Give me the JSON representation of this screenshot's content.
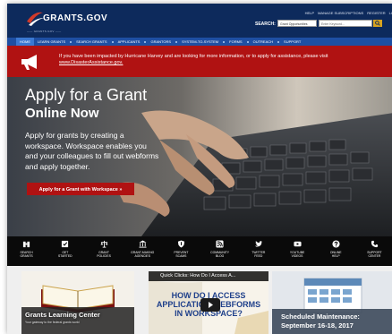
{
  "header": {
    "logo_text": "GRANTS.GOV",
    "tagline": "—— GRANTS.GOV ——",
    "util_links": [
      "HELP",
      "MANAGE SUBSCRIPTIONS",
      "REGISTER",
      "LO"
    ],
    "search_label": "SEARCH:",
    "search_select": "Grant Opportunities",
    "search_placeholder": "Enter Keyword..."
  },
  "nav": {
    "items": [
      "HOME",
      "LEARN GRANTS",
      "SEARCH GRANTS",
      "APPLICANTS",
      "GRANTORS",
      "SYSTEM-TO-SYSTEM",
      "FORMS",
      "OUTREACH",
      "SUPPORT"
    ]
  },
  "alert": {
    "text": "If you have been impacted by Hurricane Harvey and are looking for more information, or to apply for assistance, please visit",
    "link": "www.DisasterAssistance.gov."
  },
  "hero": {
    "title_line1": "Apply for a Grant",
    "title_line2": "Online Now",
    "body": "Apply for grants by creating a workspace. Workspace enables you and your colleagues to fill out webforms and apply together.",
    "cta": "Apply for a Grant with Workspace »"
  },
  "iconbar": {
    "items": [
      {
        "label1": "SEARCH",
        "label2": "GRANTS",
        "icon": "binoculars-icon"
      },
      {
        "label1": "GET",
        "label2": "STARTED",
        "icon": "checkbox-icon"
      },
      {
        "label1": "GRANT",
        "label2": "POLICIES",
        "icon": "scales-icon"
      },
      {
        "label1": "GRANT-MAKING",
        "label2": "AGENCIES",
        "icon": "building-icon"
      },
      {
        "label1": "PREVENT",
        "label2": "SCAMS",
        "icon": "shield-icon"
      },
      {
        "label1": "COMMUNITY",
        "label2": "BLOG",
        "icon": "rss-icon"
      },
      {
        "label1": "TWITTER",
        "label2": "FEED",
        "icon": "twitter-icon"
      },
      {
        "label1": "YOUTUBE",
        "label2": "VIDEOS",
        "icon": "youtube-icon"
      },
      {
        "label1": "ONLINE",
        "label2": "HELP",
        "icon": "help-icon"
      },
      {
        "label1": "SUPPORT",
        "label2": "CENTER",
        "icon": "phone-icon"
      }
    ]
  },
  "cards": {
    "learning": {
      "title": "Grants Learning Center",
      "subtitle": "Your gateway to the federal grants world"
    },
    "video": {
      "bar_title": "Quick Clicks: How Do I Access A...",
      "headline": "HOW DO I ACCESS APPLICATION WEBFORMS IN WORKSPACE?"
    },
    "maintenance": {
      "title_line1": "Scheduled Maintenance:",
      "title_line2": "September 16-18, 2017"
    }
  },
  "colors": {
    "header": "#0d2a5c",
    "nav": "#1e4fa3",
    "alert": "#b01212",
    "cta": "#b01212"
  }
}
